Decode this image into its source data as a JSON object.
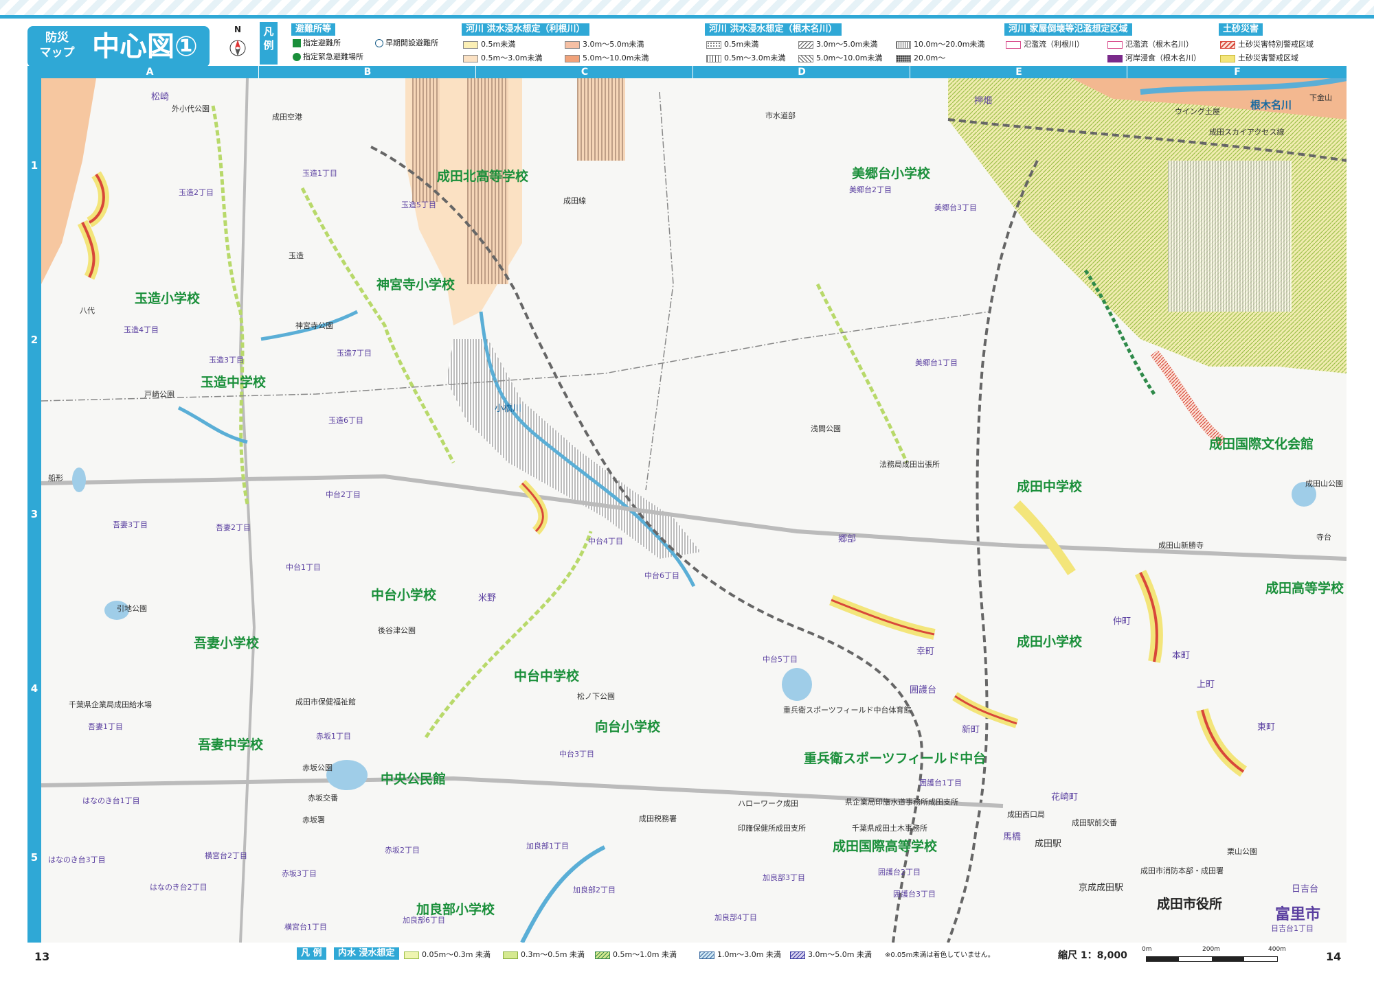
{
  "header": {
    "title_small": "防災\nマップ",
    "title_big": "中心図①",
    "compass_label": "N",
    "legend_label": "凡\n例"
  },
  "legend": {
    "shelter": {
      "title": "避難所等",
      "items": [
        "指定避難所",
        "指定緊急避難場所",
        "早期開設避難所"
      ]
    },
    "tone": {
      "title": "河川 洪水浸水想定（利根川）",
      "items": [
        "0.5m未満",
        "0.5m～3.0m未満",
        "3.0m～5.0m未満",
        "5.0m～10.0m未満"
      ],
      "colors": [
        "#fbefb5",
        "#fbe1c3",
        "#f6c0a4",
        "#f0a27a"
      ]
    },
    "nekina": {
      "title": "河川 洪水浸水想定（根木名川）",
      "items": [
        "0.5m未満",
        "0.5m～3.0m未満",
        "3.0m～5.0m未満",
        "5.0m～10.0m未満",
        "10.0m～20.0m未満",
        "20.0m～"
      ]
    },
    "collapse": {
      "title": "河川 家屋倒壊等氾濫想定区域",
      "items": [
        "氾濫流（利根川）",
        "氾濫流（根木名川）",
        "河岸浸食（根木名川）"
      ]
    },
    "landslide": {
      "title": "土砂災害",
      "items": [
        "土砂災害特別警戒区域",
        "土砂災害警戒区域"
      ]
    }
  },
  "grid": {
    "columns": [
      "A",
      "B",
      "C",
      "D",
      "E",
      "F"
    ],
    "rows": [
      "1",
      "2",
      "3",
      "4",
      "5"
    ]
  },
  "map_labels": {
    "schools": [
      "成田北高等学校",
      "美郷台小学校",
      "神宮寺小学校",
      "玉造小学校",
      "玉造中学校",
      "成田中学校",
      "成田国際文化会館",
      "中台小学校",
      "成田高等学校",
      "吾妻小学校",
      "成田小学校",
      "中台中学校",
      "向台小学校",
      "吾妻中学校",
      "重兵衛スポーツフィールド中台",
      "中央公民館",
      "成田国際高等学校",
      "加良部小学校",
      "成田市役所"
    ],
    "places": [
      "松崎",
      "外小代公園",
      "成田空港",
      "市水道部",
      "押畑",
      "ウイング土屋",
      "根木名川",
      "下金山",
      "成田線",
      "成田スカイアクセス線",
      "玉造",
      "八代",
      "神宮寺公園",
      "戸崎公園",
      "小橋川",
      "浅間公園",
      "法務局成田出張所",
      "船形",
      "成田山公園",
      "郷部",
      "寺台",
      "成田山新勝寺",
      "米野",
      "後谷津公園",
      "引地公園",
      "仲町",
      "本町",
      "上町",
      "幸町",
      "囲護台",
      "新町",
      "東町",
      "千葉県企業局成田給水場",
      "成田市保健福祉館",
      "赤坂公園",
      "赤坂交番",
      "赤坂署",
      "成田税務署",
      "成田駅",
      "京成成田駅",
      "花崎町",
      "馬橋",
      "成田市消防本部・成田署",
      "栗山公園",
      "成田駅前交番",
      "松ノ下公園",
      "重兵衛スポーツフィールド中台体育館",
      "ハローワーク成田",
      "県企業局印旛水道事務所成田支所",
      "印旛保健所成田支所",
      "千葉県成田土木事務所",
      "成田西口局",
      "日吉台"
    ],
    "areas": [
      "玉造2丁目",
      "玉造1丁目",
      "玉造5丁目",
      "玉造4丁目",
      "玉造3丁目",
      "玉造7丁目",
      "玉造6丁目",
      "美郷台2丁目",
      "美郷台3丁目",
      "美郷台1丁目",
      "中台2丁目",
      "吾妻3丁目",
      "吾妻2丁目",
      "中台1丁目",
      "中台4丁目",
      "中台6丁目",
      "吾妻1丁目",
      "中台5丁目",
      "赤坂1丁目",
      "中台3丁目",
      "囲護台1丁目",
      "はなのき台1丁目",
      "はなのき台3丁目",
      "はなのき台2丁目",
      "横宮台2丁目",
      "赤坂3丁目",
      "赤坂2丁目",
      "加良部1丁目",
      "加良部2丁目",
      "加良部3丁目",
      "加良部4丁目",
      "加良部6丁目",
      "横宮台1丁目",
      "囲護台2丁目",
      "囲護台3丁目",
      "日吉台1丁目",
      "富里市"
    ]
  },
  "footer": {
    "page_left": "13",
    "page_right": "14",
    "legend_label": "凡 例",
    "inundation_title": "内水 浸水想定",
    "inundation_items": [
      "0.05m～0.3m 未満",
      "0.3m～0.5m 未満",
      "0.5m～1.0m 未満",
      "1.0m～3.0m 未満",
      "3.0m～5.0m 未満"
    ],
    "note": "※0.05m未満は着色していません。",
    "scale_label": "縮尺 1：8,000",
    "scale_ticks": [
      "0m",
      "200m",
      "400m"
    ]
  },
  "colors": {
    "accent": "#2fa8d6",
    "school": "#1a8f3a",
    "landslide_red": "#d8473a",
    "landslide_yellow": "#f3e57a",
    "inland_green": "#b8d96a",
    "river_blue": "#5aaed6",
    "tone_orange": "#f6c7a0"
  }
}
